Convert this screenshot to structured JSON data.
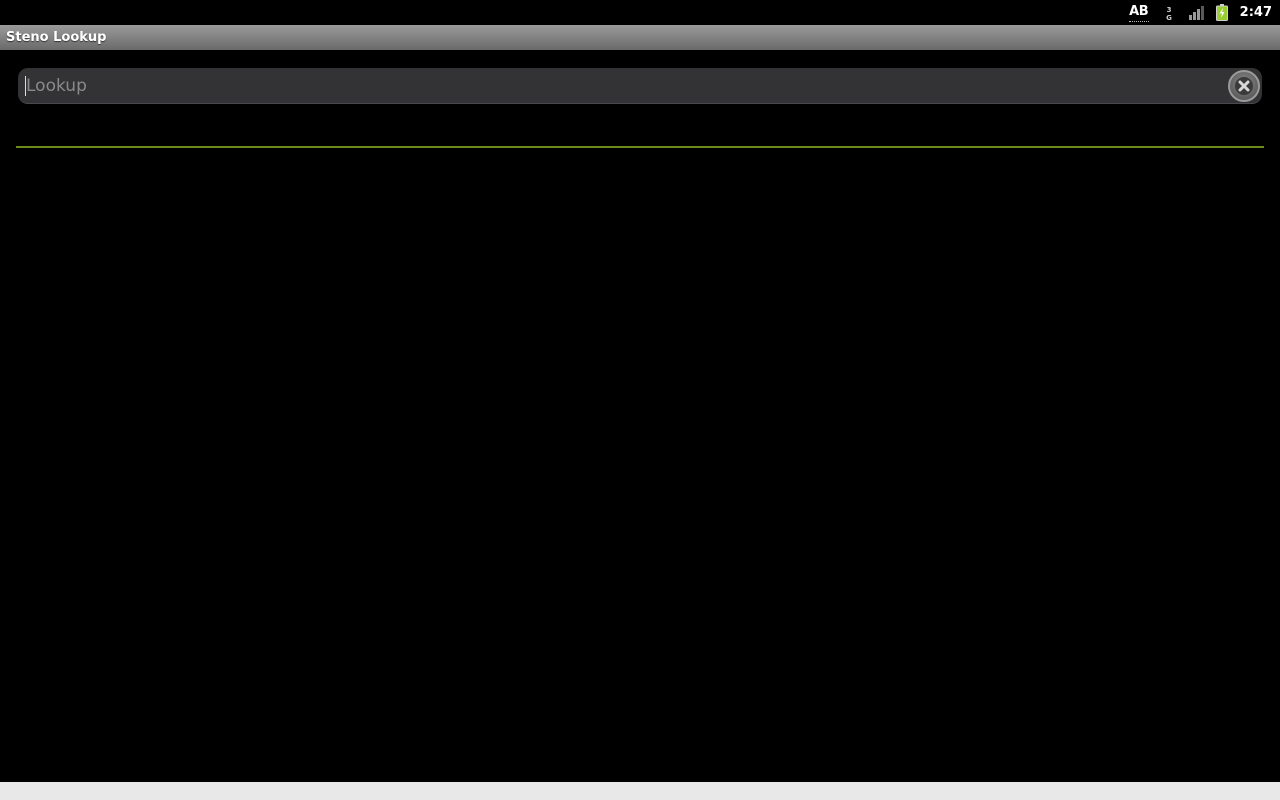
{
  "status_bar": {
    "ime_label": "AB",
    "network_label": "3G",
    "clock": "2:47",
    "icons": [
      "ime-ab-icon",
      "network-3g-icon",
      "signal-strength-icon",
      "battery-charging-icon"
    ],
    "battery_color": "#9acd32"
  },
  "title_bar": {
    "title": "Steno Lookup"
  },
  "search": {
    "placeholder": "Lookup",
    "value": "",
    "clear_icon": "clear-x-icon"
  },
  "colors": {
    "divider": "#6f8a1c",
    "background": "#000000",
    "field_background": "#333336"
  }
}
